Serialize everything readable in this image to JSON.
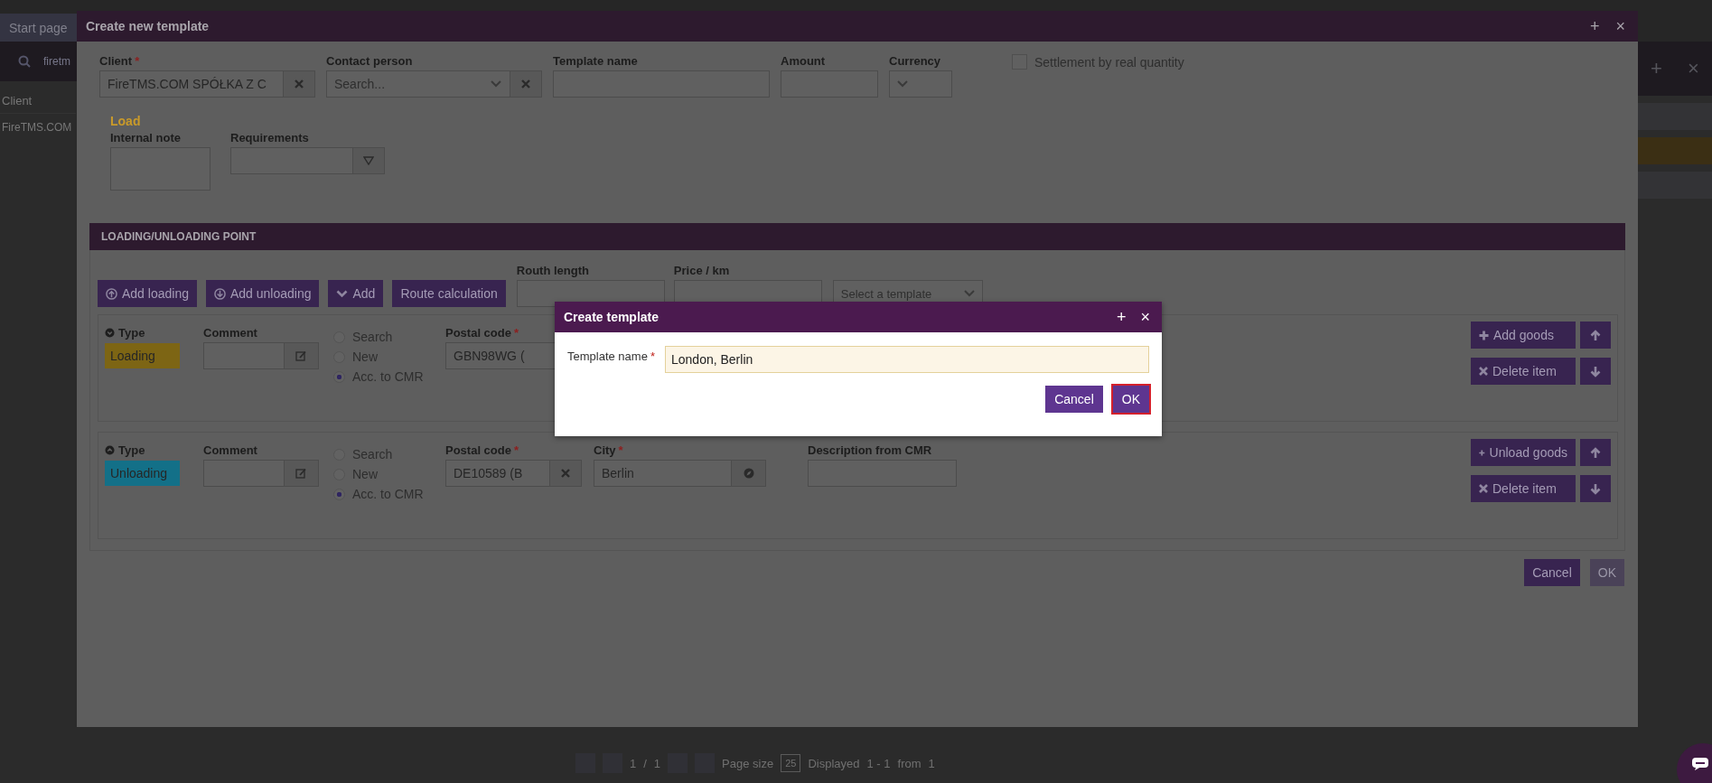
{
  "background": {
    "tabs": [
      {
        "label": "Start page",
        "selected": true
      }
    ],
    "search": {
      "value": "firetm"
    },
    "window_buttons": [
      "+",
      "×"
    ],
    "table": {
      "columns": [
        "Client"
      ],
      "rows": [
        {
          "cells": [
            "FireTMS.COM"
          ],
          "selected": false
        },
        {
          "cells": [
            ""
          ],
          "selected": true
        }
      ]
    },
    "pagination": {
      "page": "1",
      "separator": "/",
      "pages": "1",
      "page_size_label": "Page size",
      "page_size": "25",
      "displayed_label": "Displayed",
      "displayed": "1 - 1",
      "from_label": "from",
      "total": "1"
    }
  },
  "window": {
    "title": "Create new template",
    "buttons": [
      "+",
      "×"
    ]
  },
  "form": {
    "client": {
      "label": "Client",
      "required_mark": "*",
      "value": "FireTMS.COM SPÓŁKA Z C"
    },
    "contact_person": {
      "label": "Contact person",
      "placeholder": "Search..."
    },
    "template_name": {
      "label": "Template name"
    },
    "amount": {
      "label": "Amount"
    },
    "currency": {
      "label": "Currency"
    },
    "settlement": {
      "label": "Settlement by real quantity",
      "checked": false
    },
    "load_heading": "Load",
    "internal_note": {
      "label": "Internal note"
    },
    "requirements": {
      "label": "Requirements"
    }
  },
  "section": {
    "title": "LOADING/UNLOADING POINT",
    "buttons": [
      {
        "label": "Add loading",
        "kind": "loading"
      },
      {
        "label": "Add unloading",
        "kind": "unloading"
      },
      {
        "label": "Add",
        "kind": "add"
      },
      {
        "label": "Route calculation",
        "kind": "route"
      }
    ],
    "route_length": {
      "label": "Routh length"
    },
    "price_per_km": {
      "label": "Price / km"
    },
    "template_select": {
      "placeholder": "Select a template"
    },
    "points": [
      {
        "kind": "loading",
        "type_label": "Type",
        "type": "Loading",
        "comment_label": "Comment",
        "options": [
          {
            "label": "Search",
            "selected": false
          },
          {
            "label": "New",
            "selected": false
          },
          {
            "label": "Acc. to CMR",
            "selected": true
          }
        ],
        "postal_label": "Postal code",
        "postal_mark": "*",
        "postal_value": "GBN98WG (",
        "goods_button": "Add goods",
        "delete_button": "Delete item"
      },
      {
        "kind": "unloading",
        "type_label": "Type",
        "type": "Unloading",
        "comment_label": "Comment",
        "options": [
          {
            "label": "Search",
            "selected": false
          },
          {
            "label": "New",
            "selected": false
          },
          {
            "label": "Acc. to CMR",
            "selected": true
          }
        ],
        "postal_label": "Postal code",
        "postal_mark": "*",
        "postal_value": "DE10589 (B",
        "city_label": "City",
        "city_mark": "*",
        "city_value": "Berlin",
        "description_label": "Description from CMR",
        "goods_button": "Unload goods",
        "delete_button": "Delete item"
      }
    ]
  },
  "footer": {
    "cancel": "Cancel",
    "ok": {
      "label": "OK",
      "disabled": true
    }
  },
  "dialog": {
    "title": "Create template",
    "buttons": [
      "+",
      "×"
    ],
    "field": {
      "label": "Template name",
      "required_mark": "*",
      "value": "London, Berlin"
    },
    "cancel": "Cancel",
    "ok": {
      "label": "OK",
      "focused": true
    }
  }
}
